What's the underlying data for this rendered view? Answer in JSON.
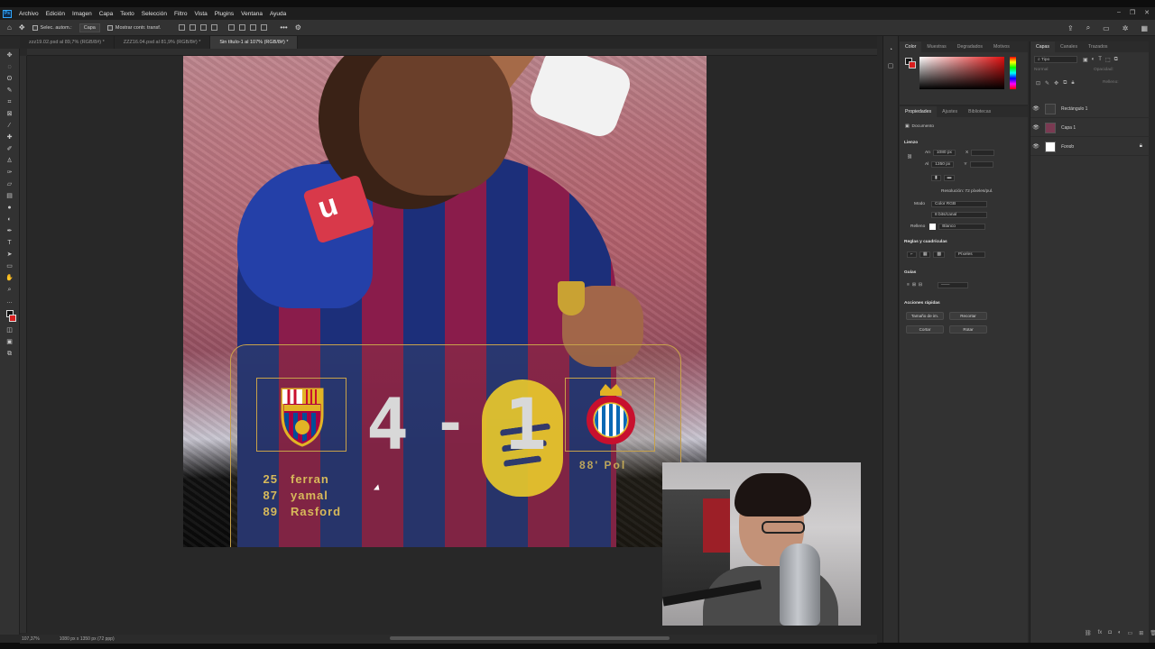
{
  "menubar": {
    "logo": "Ps",
    "items": [
      "Archivo",
      "Edición",
      "Imagen",
      "Capa",
      "Texto",
      "Selección",
      "Filtro",
      "Vista",
      "Plugins",
      "Ventana",
      "Ayuda"
    ]
  },
  "options": {
    "auto_select": "Selec. autom.:",
    "auto_select_target": "Capa",
    "show_transform": "Mostrar contr. transf."
  },
  "tabs": [
    {
      "label": "zzz19.02.psd al 89,7% (RGB/8#) *",
      "active": false
    },
    {
      "label": "ZZZ16.04.psd al 81,9% (RGB/8#) *",
      "active": false
    },
    {
      "label": "Sin título-1 al 107% (RGB/8#) *",
      "active": true
    }
  ],
  "canvas": {
    "sponsor_mark": "u",
    "score_home": "4",
    "score_separator": "-",
    "score_away": "1",
    "scorers": [
      {
        "minute": "25",
        "name": "ferran"
      },
      {
        "minute": "87",
        "name": "yamal"
      },
      {
        "minute": "89",
        "name": "Rasford"
      }
    ],
    "away_scorer": "88' Pol"
  },
  "statusbar": {
    "zoom": "107,37%",
    "doc_size": "1080 px x 1350 px (72 ppp)"
  },
  "color_panel": {
    "tabs": [
      "Color",
      "Muestras",
      "Degradados",
      "Motivos"
    ]
  },
  "properties": {
    "tabs": [
      "Propiedades",
      "Ajustes",
      "Bibliotecas"
    ],
    "doc_label": "Documento",
    "canvas_section": "Lienzo",
    "width_label": "An",
    "width_value": "1080 px",
    "x_label": "X",
    "height_label": "Al",
    "height_value": "1350 px",
    "y_label": "Y",
    "resolution": "Resolución: 72 píxeles/pul.",
    "mode_label": "Modo",
    "mode_value": "Color RGB",
    "depth_value": "8 bits/canal",
    "fill_label": "Relleno",
    "fill_value": "Blanco",
    "rulers_section": "Reglas y cuadrículas",
    "units_value": "Píxeles",
    "guides_section": "Guías",
    "quick_actions": "Acciones rápidas",
    "btn_image_size": "Tamaño de im.",
    "btn_crop": "Recortar",
    "btn_cut": "Cortar",
    "btn_rotate": "Rotar"
  },
  "layers": {
    "tabs": [
      "Capas",
      "Canales",
      "Trazados"
    ],
    "search_kind": "Tipo",
    "blend_mode": "Normal",
    "opacity_label": "Opacidad:",
    "fill_label": "Relleno:",
    "items": [
      {
        "name": "Rectángulo 1",
        "thumb_color": "#3a3a3a"
      },
      {
        "name": "Capa 1",
        "thumb_color": "#7a3a52"
      },
      {
        "name": "Fondo",
        "thumb_color": "#ffffff"
      }
    ]
  }
}
